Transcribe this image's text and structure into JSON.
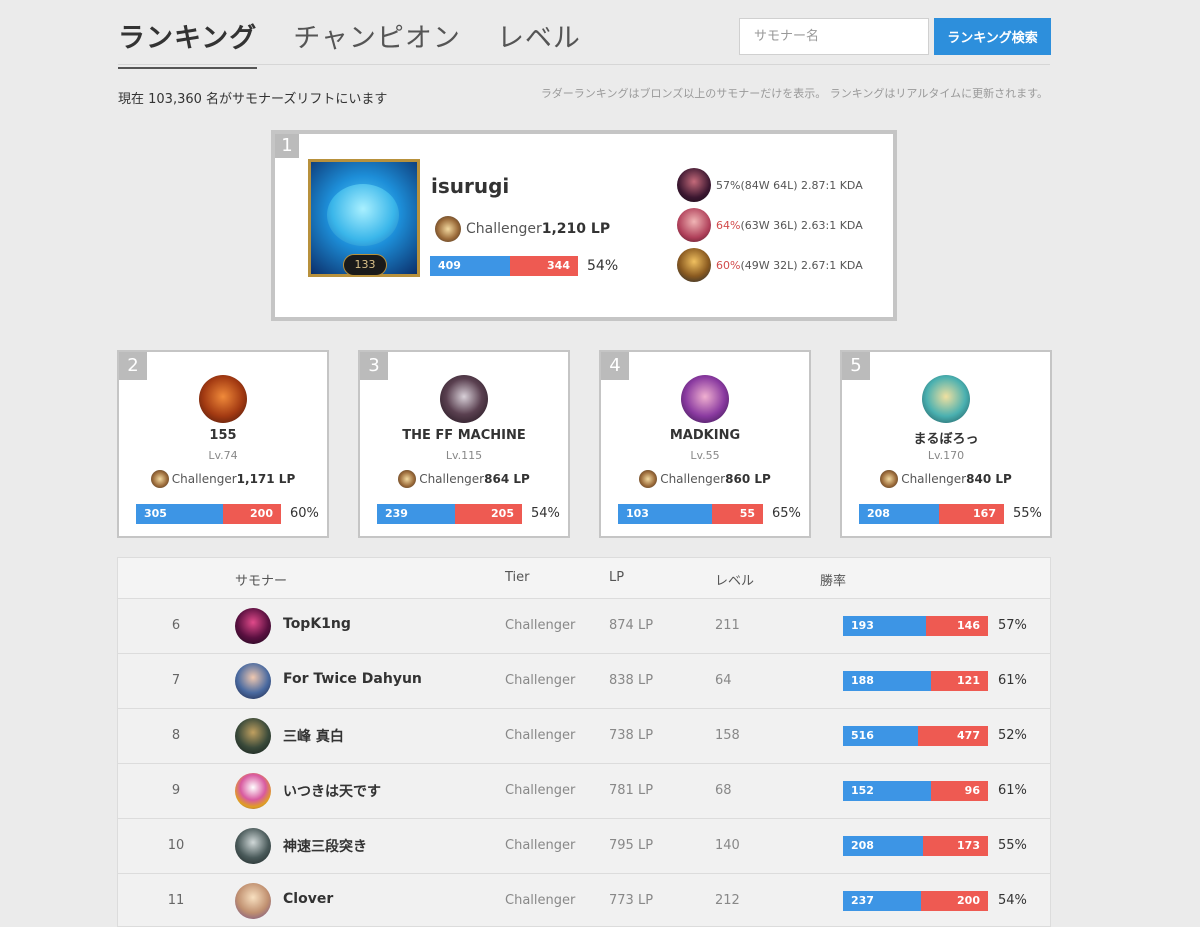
{
  "nav": {
    "tabs": [
      {
        "label": "ランキング",
        "active": true
      },
      {
        "label": "チャンピオン",
        "active": false
      },
      {
        "label": "レベル",
        "active": false
      }
    ]
  },
  "search": {
    "placeholder": "サモナー名",
    "button_label": "ランキング検索"
  },
  "info": {
    "summoner_count": "現在 103,360 名がサモナーズリフトにいます",
    "ladder_note": "ラダーランキングはブロンズ以上のサモナーだけを表示。 ランキングはリアルタイムに更新されます。"
  },
  "colors": {
    "win": "#3d95e5",
    "loss": "#ee5a52",
    "accent": "#2d8fdc"
  },
  "top1": {
    "rank": "1",
    "name": "isurugi",
    "level": "133",
    "tier": "Challenger",
    "lp": "1,210 LP",
    "wins": "409",
    "losses": "344",
    "winrate": "54%",
    "champions": [
      {
        "icon": "champion-icon-dark",
        "rate": "57%",
        "record": " (84W 64L) 2.87:1 KDA",
        "highlight": false
      },
      {
        "icon": "champion-icon-pink",
        "rate": "64%",
        "record": " (63W 36L) 2.63:1 KDA",
        "highlight": true
      },
      {
        "icon": "champion-icon-gold",
        "rate": "60%",
        "record": " (49W 32L) 2.67:1 KDA",
        "highlight": true
      }
    ]
  },
  "top_cards": [
    {
      "rank": "2",
      "name": "155",
      "level": "Lv.74",
      "tier": "Challenger",
      "lp": "1,171 LP",
      "wins": "305",
      "losses": "200",
      "winrate": "60%"
    },
    {
      "rank": "3",
      "name": "THE FF MACHINE",
      "level": "Lv.115",
      "tier": "Challenger",
      "lp": "864 LP",
      "wins": "239",
      "losses": "205",
      "winrate": "54%"
    },
    {
      "rank": "4",
      "name": "MADKING",
      "level": "Lv.55",
      "tier": "Challenger",
      "lp": "860 LP",
      "wins": "103",
      "losses": "55",
      "winrate": "65%"
    },
    {
      "rank": "5",
      "name": "まるぼろっ",
      "level": "Lv.170",
      "tier": "Challenger",
      "lp": "840 LP",
      "wins": "208",
      "losses": "167",
      "winrate": "55%"
    }
  ],
  "table": {
    "headers": {
      "summoner": "サモナー",
      "tier": "Tier",
      "lp": "LP",
      "level": "レベル",
      "winrate": "勝率"
    },
    "rows": [
      {
        "rank": "6",
        "name": "TopK1ng",
        "tier": "Challenger",
        "lp": "874 LP",
        "level": "211",
        "wins": "193",
        "losses": "146",
        "winrate": "57%"
      },
      {
        "rank": "7",
        "name": "For Twice Dahyun",
        "tier": "Challenger",
        "lp": "838 LP",
        "level": "64",
        "wins": "188",
        "losses": "121",
        "winrate": "61%"
      },
      {
        "rank": "8",
        "name": "三峰 真白",
        "tier": "Challenger",
        "lp": "738 LP",
        "level": "158",
        "wins": "516",
        "losses": "477",
        "winrate": "52%"
      },
      {
        "rank": "9",
        "name": "いつきは天です",
        "tier": "Challenger",
        "lp": "781 LP",
        "level": "68",
        "wins": "152",
        "losses": "96",
        "winrate": "61%"
      },
      {
        "rank": "10",
        "name": "神速三段突き",
        "tier": "Challenger",
        "lp": "795 LP",
        "level": "140",
        "wins": "208",
        "losses": "173",
        "winrate": "55%"
      },
      {
        "rank": "11",
        "name": "Clover",
        "tier": "Challenger",
        "lp": "773 LP",
        "level": "212",
        "wins": "237",
        "losses": "200",
        "winrate": "54%"
      }
    ]
  }
}
